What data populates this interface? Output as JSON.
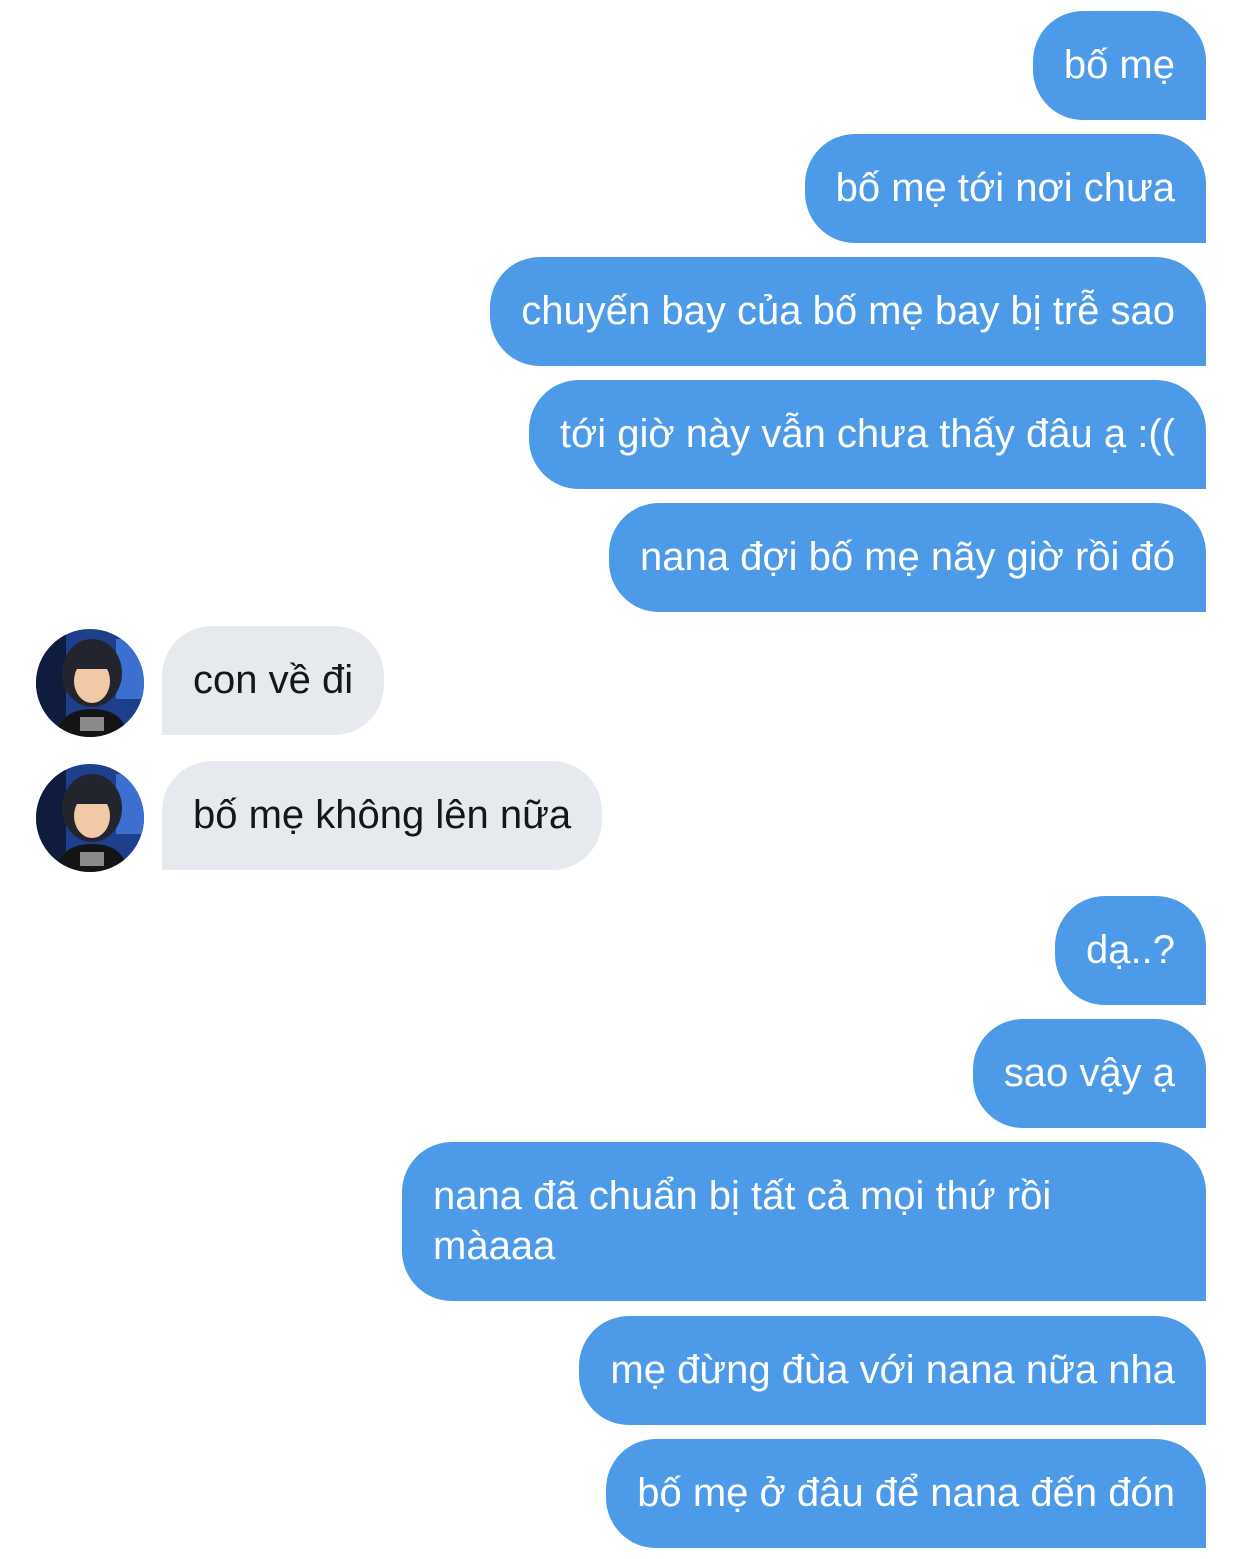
{
  "conversation": {
    "messages": [
      {
        "from": "me",
        "text": "bố mẹ"
      },
      {
        "from": "me",
        "text": "bố mẹ tới nơi chưa"
      },
      {
        "from": "me",
        "text": "chuyến bay của bố mẹ bay bị trễ sao"
      },
      {
        "from": "me",
        "text": "tới giờ này vẫn chưa thấy đâu ạ :(("
      },
      {
        "from": "me",
        "text": "nana đợi bố mẹ nãy giờ rồi đó"
      },
      {
        "from": "them",
        "text": "con về đi"
      },
      {
        "from": "them",
        "text": "bố mẹ không lên nữa"
      },
      {
        "from": "me",
        "text": "dạ..?"
      },
      {
        "from": "me",
        "text": "sao vậy ạ"
      },
      {
        "from": "me",
        "text": "nana đã chuẩn bị tất cả mọi thứ rồi màaaa"
      },
      {
        "from": "me",
        "text": "mẹ đừng đùa với nana nữa nha"
      },
      {
        "from": "me",
        "text": "bố mẹ ở đâu để nana đến đón"
      }
    ]
  },
  "colors": {
    "outgoing_bubble": "#4d9be8",
    "incoming_bubble": "#e6eaee",
    "incoming_text": "#14171a"
  },
  "icons": {
    "avatar": "avatar-photo-icon"
  }
}
